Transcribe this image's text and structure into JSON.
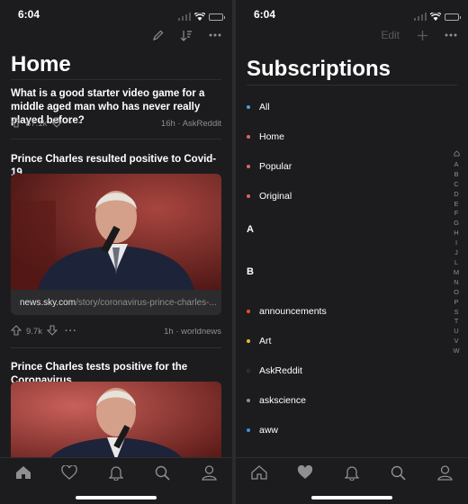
{
  "status": {
    "time": "6:04"
  },
  "home": {
    "title": "Home",
    "posts": [
      {
        "title": "What is a good starter video game for a middle aged man who has never really played before?",
        "votes": "67.1k",
        "age": "16h · AskReddit"
      },
      {
        "title": "Prince Charles resulted positive to Covid-19",
        "link_domain": "news.sky.com",
        "link_path": "/story/coronavirus-prince-charles-...",
        "votes": "9.7k",
        "age": "1h · worldnews"
      },
      {
        "title": "Prince Charles tests positive for the Coronavirus"
      }
    ]
  },
  "subs": {
    "edit": "Edit",
    "title": "Subscriptions",
    "top": [
      {
        "label": "All",
        "color": "#4a9fe0"
      },
      {
        "label": "Home",
        "color": "#e0655f"
      },
      {
        "label": "Popular",
        "color": "#e0655f"
      },
      {
        "label": "Original",
        "color": "#e0655f"
      }
    ],
    "section_a": "A",
    "section_b": "B",
    "items": [
      {
        "label": "announcements",
        "color": "#e8522e"
      },
      {
        "label": "Art",
        "color": "#e6c229"
      },
      {
        "label": "AskReddit",
        "color": "#1c1c1e"
      },
      {
        "label": "askscience",
        "color": "#8e8e93"
      },
      {
        "label": "aww",
        "color": "#3d8fe0"
      }
    ],
    "index": [
      "A",
      "B",
      "C",
      "D",
      "E",
      "F",
      "G",
      "H",
      "I",
      "J",
      "L",
      "M",
      "N",
      "O",
      "P",
      "S",
      "T",
      "U",
      "V",
      "W"
    ]
  }
}
